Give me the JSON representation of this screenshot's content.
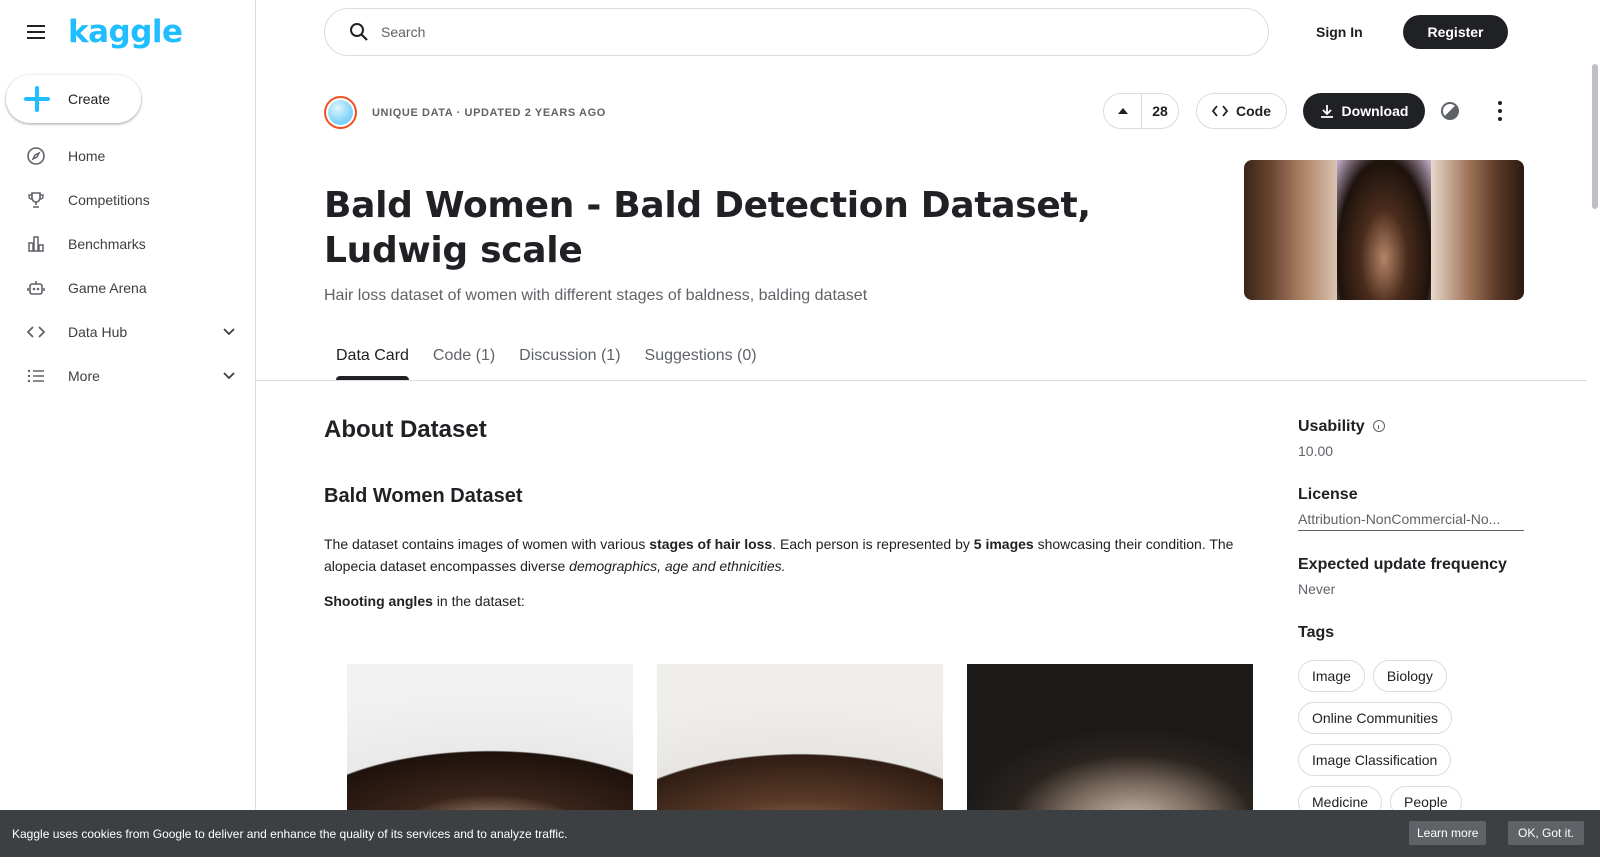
{
  "brand": {
    "logo_text": "kaggle",
    "accent_color": "#20beff",
    "dark_color": "#202124"
  },
  "sidebar": {
    "create_label": "Create",
    "items": [
      {
        "label": "Home",
        "icon": "compass-icon"
      },
      {
        "label": "Competitions",
        "icon": "trophy-icon"
      },
      {
        "label": "Benchmarks",
        "icon": "bar-chart-icon"
      },
      {
        "label": "Game Arena",
        "icon": "robot-icon"
      },
      {
        "label": "Data Hub",
        "icon": "code-brackets-icon",
        "expandable": true
      },
      {
        "label": "More",
        "icon": "list-icon",
        "expandable": true
      }
    ]
  },
  "header": {
    "search_placeholder": "Search",
    "sign_in": "Sign In",
    "register": "Register"
  },
  "dataset": {
    "meta": "UNIQUE DATA · UPDATED 2 YEARS AGO",
    "votes": "28",
    "code_label": "Code",
    "download_label": "Download",
    "title": "Bald Women - Bald Detection Dataset, Ludwig scale",
    "subtitle": "Hair loss dataset of women with different stages of baldness, balding dataset"
  },
  "tabs": [
    {
      "label": "Data Card",
      "active": true
    },
    {
      "label": "Code (1)",
      "active": false
    },
    {
      "label": "Discussion (1)",
      "active": false
    },
    {
      "label": "Suggestions (0)",
      "active": false
    }
  ],
  "content": {
    "about_heading": "About Dataset",
    "section_heading": "Bald Women Dataset",
    "para_part1": "The dataset contains images of women with various ",
    "para_bold1": "stages of hair loss",
    "para_part2": ". Each person is represented by ",
    "para_bold2": "5 images",
    "para_part3": " showcasing their condition. The alopecia dataset encompasses diverse ",
    "para_italic": "demographics, age and ethnicities.",
    "angles_bold": "Shooting angles",
    "angles_rest": " in the dataset:"
  },
  "right_panel": {
    "usability_label": "Usability",
    "usability_value": "10.00",
    "license_label": "License",
    "license_value": "Attribution-NonCommercial-No...",
    "frequency_label": "Expected update frequency",
    "frequency_value": "Never",
    "tags_label": "Tags",
    "tags": [
      "Image",
      "Biology",
      "Online Communities",
      "Image Classification",
      "Medicine",
      "People"
    ]
  },
  "cookie": {
    "text": "Kaggle uses cookies from Google to deliver and enhance the quality of its services and to analyze traffic.",
    "learn_more": "Learn more",
    "ok": "OK, Got it."
  }
}
